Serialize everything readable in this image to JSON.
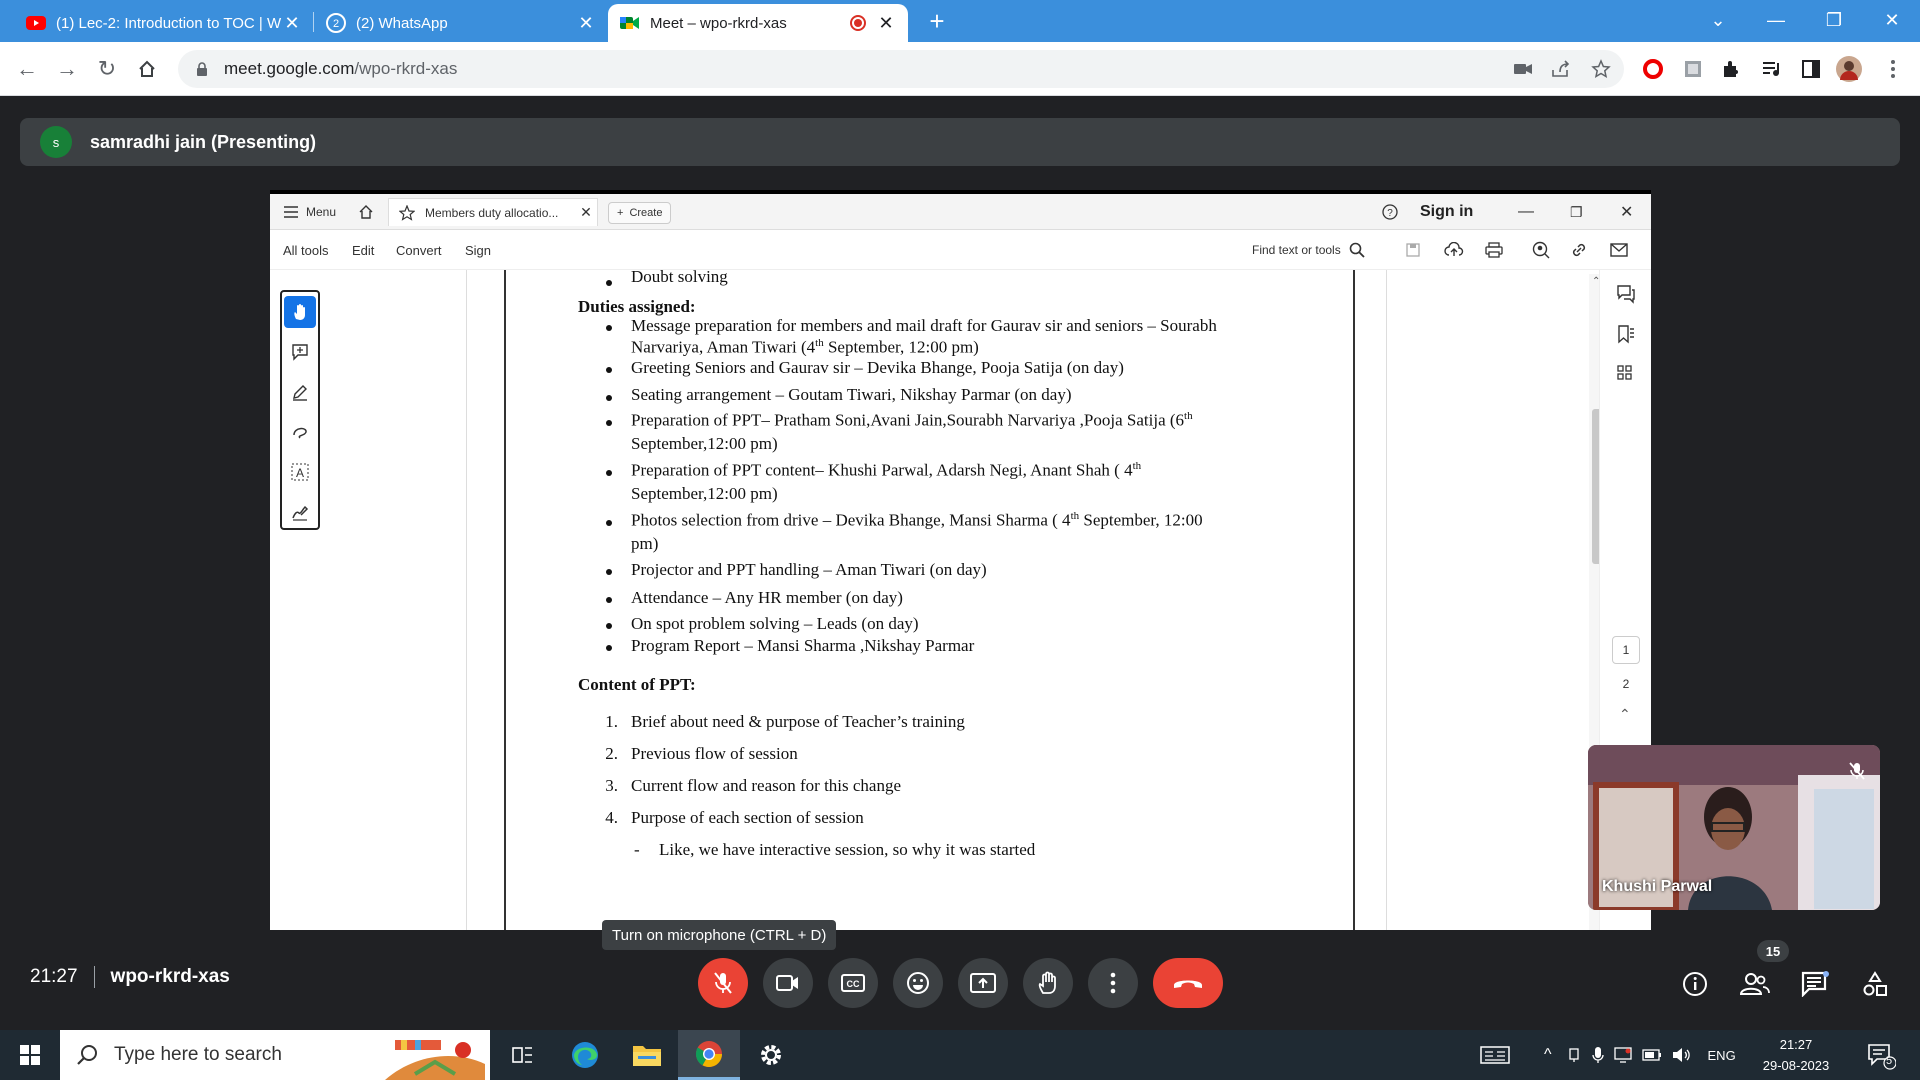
{
  "browser": {
    "tabs": [
      {
        "label": "(1) Lec-2: Introduction to TOC | W",
        "icon": "youtube-icon"
      },
      {
        "label": "(2) WhatsApp",
        "icon": "whatsapp-icon"
      },
      {
        "label": "Meet – wpo-rkrd-xas",
        "icon": "meet-icon"
      }
    ],
    "url_host": "meet.google.com",
    "url_path": "/wpo-rkrd-xas"
  },
  "meet": {
    "presenter_initial": "s",
    "presenter_label": "samradhi jain (Presenting)",
    "time": "21:27",
    "meeting_code": "wpo-rkrd-xas",
    "tooltip": "Turn on microphone (CTRL + D)",
    "participants_count": "15",
    "self_view_name": "Khushi Parwal"
  },
  "acrobat": {
    "menu_label": "Menu",
    "doc_tab": "Members duty allocatio...",
    "create_label": "Create",
    "sign_in": "Sign in",
    "menu_items": [
      "All tools",
      "Edit",
      "Convert",
      "Sign"
    ],
    "find_label": "Find text or tools",
    "pages": [
      "1",
      "2"
    ]
  },
  "document": {
    "top_bullet": "Doubt solving",
    "duties_heading": "Duties assigned:",
    "duties": [
      {
        "l1": "Message preparation for members and mail draft for Gaurav sir and seniors – Sourabh",
        "l2a": "Narvariya, Aman Tiwari (4",
        "sup": "th",
        "l2b": " September, 12:00 pm)"
      },
      {
        "l1": "Greeting Seniors and Gaurav sir – Devika Bhange, Pooja Satija (on day)"
      },
      {
        "l1": "Seating arrangement  – Goutam Tiwari, Nikshay Parmar (on day)"
      },
      {
        "l1a": "Preparation of  PPT– Pratham Soni,Avani Jain,Sourabh  Narvariya ,Pooja Satija (6",
        "sup": "th",
        "l2": "September,12:00 pm)"
      },
      {
        "l1a": "Preparation of  PPT content–  Khushi Parwal, Adarsh Negi, Anant Shah ( 4",
        "sup": "th",
        "l2": "September,12:00 pm)"
      },
      {
        "l1a": "Photos selection from drive – Devika Bhange, Mansi Sharma ( 4",
        "sup": "th",
        "l1b": " September, 12:00",
        "l2": "pm)"
      },
      {
        "l1": "Projector and PPT handling – Aman Tiwari (on day)"
      },
      {
        "l1": "Attendance – Any HR member (on day)"
      },
      {
        "l1": "On spot problem solving – Leads (on day)"
      },
      {
        "l1": "Program Report – Mansi Sharma ,Nikshay Parmar"
      }
    ],
    "content_heading": "Content of PPT:",
    "content_items": [
      {
        "n": "1.",
        "t": "Brief about need & purpose of Teacher’s training"
      },
      {
        "n": "2.",
        "t": "Previous flow of session"
      },
      {
        "n": "3.",
        "t": "Current flow and reason for this change"
      },
      {
        "n": "4.",
        "t": "Purpose of each section of session"
      }
    ],
    "sub_dash": "-",
    "sub_item": "Like, we have interactive session, so why it was started"
  },
  "taskbar": {
    "search_placeholder": "Type here to search",
    "lang": "ENG",
    "time": "21:27",
    "date": "29-08-2023",
    "notif": "5"
  },
  "colors": {
    "tab_bar": "#3b8fdc",
    "meet_bg": "#202124",
    "end_call": "#ea4335",
    "acrobat_selected": "#1473e6"
  }
}
